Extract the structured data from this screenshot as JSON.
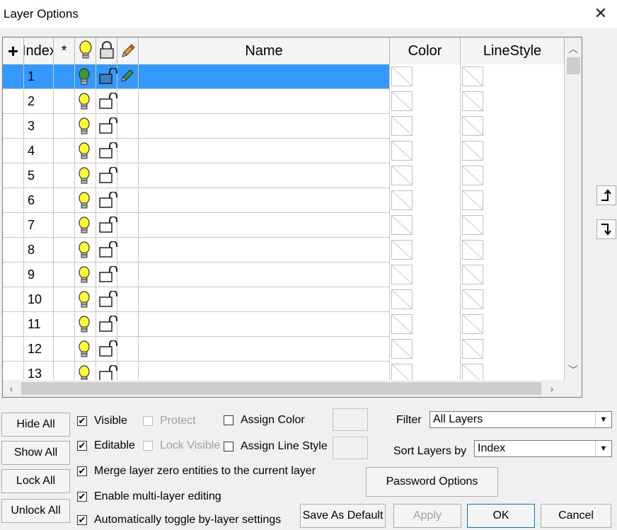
{
  "window": {
    "title": "Layer Options"
  },
  "grid": {
    "headers": {
      "add": "+",
      "index": "Index",
      "star": "*",
      "name": "Name",
      "color": "Color",
      "linestyle": "LineStyle"
    },
    "rows": [
      {
        "index": "1",
        "selected": true,
        "visible_icon": "bulb-green",
        "lock_icon": "unlocked-blue",
        "edit_icon": "pencil-green"
      },
      {
        "index": "2"
      },
      {
        "index": "3"
      },
      {
        "index": "4"
      },
      {
        "index": "5"
      },
      {
        "index": "6"
      },
      {
        "index": "7"
      },
      {
        "index": "8"
      },
      {
        "index": "9"
      },
      {
        "index": "10"
      },
      {
        "index": "11"
      },
      {
        "index": "12"
      },
      {
        "index": "13"
      }
    ]
  },
  "side_buttons": {
    "up_icon": "move-up-icon",
    "down_icon": "move-down-icon"
  },
  "buttons": {
    "hide_all": "Hide All",
    "show_all": "Show All",
    "lock_all": "Lock All",
    "unlock_all": "Unlock All",
    "password_options": "Password Options",
    "save_default": "Save As Default",
    "apply": "Apply",
    "ok": "OK",
    "cancel": "Cancel"
  },
  "options": {
    "visible": {
      "label": "Visible",
      "checked": true
    },
    "protect": {
      "label": "Protect",
      "checked": false,
      "disabled": true
    },
    "assign_color": {
      "label": "Assign Color",
      "checked": false
    },
    "editable": {
      "label": "Editable",
      "checked": true
    },
    "lock_visible": {
      "label": "Lock Visible",
      "checked": false,
      "disabled": true
    },
    "assign_linestyle": {
      "label": "Assign Line Style",
      "checked": false
    },
    "merge_zero": {
      "label": "Merge layer zero entities to the current layer",
      "checked": true
    },
    "multi_edit": {
      "label": "Enable multi-layer editing",
      "checked": true
    },
    "auto_toggle": {
      "label": "Automatically toggle by-layer settings",
      "checked": true
    }
  },
  "filter": {
    "label": "Filter",
    "value": "All Layers"
  },
  "sort": {
    "label": "Sort Layers by",
    "value": "Index"
  },
  "colors": {
    "selection": "#3399ff",
    "bulb_yellow": "#ffff33",
    "bulb_green": "#3a9a3a",
    "lock_blue": "#3b7fc4"
  }
}
